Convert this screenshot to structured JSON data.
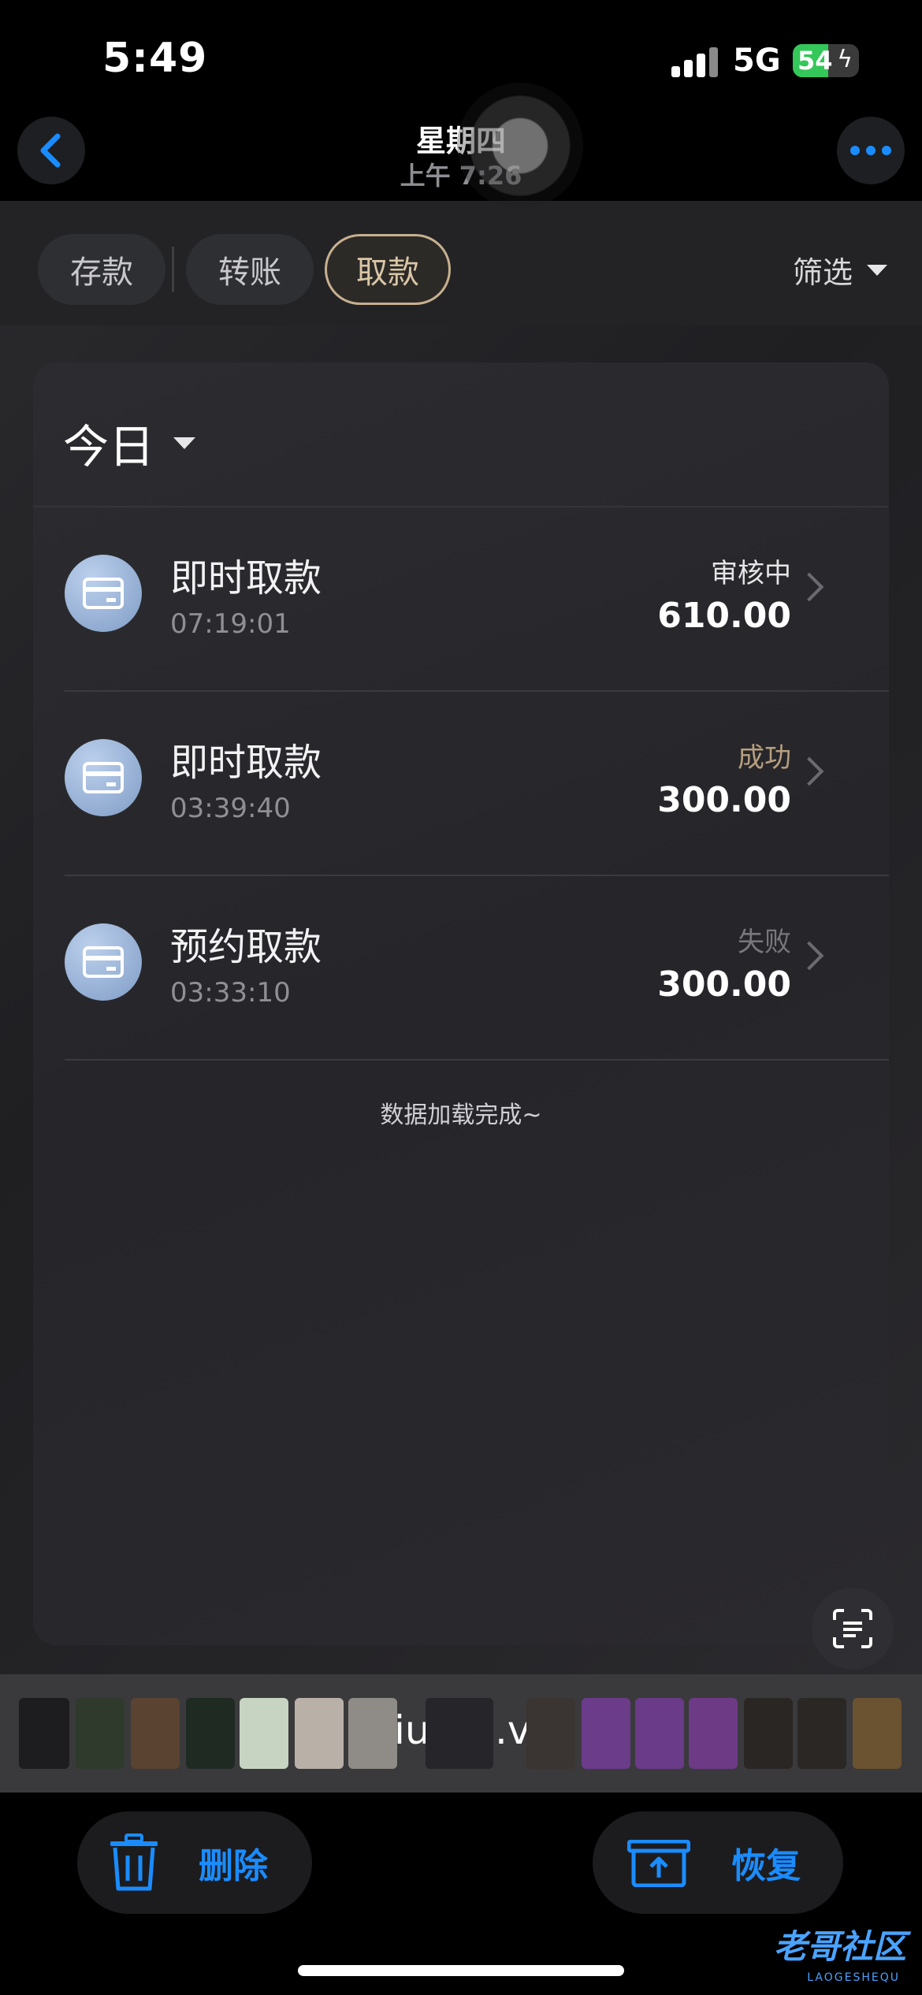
{
  "status_bar": {
    "time": "5:49",
    "network": "5G",
    "battery": "54",
    "battery_level": 0.54
  },
  "viewer_nav": {
    "title": "星期四",
    "subtitle": "上午 7:26"
  },
  "tabs": [
    {
      "label": "存款",
      "active": false
    },
    {
      "label": "转账",
      "active": false
    },
    {
      "label": "取款",
      "active": true
    }
  ],
  "filter": {
    "label": "筛选"
  },
  "period": {
    "label": "今日"
  },
  "transactions": [
    {
      "title": "即时取款",
      "time": "07:19:01",
      "status": "审核中",
      "status_color": "#e6e6e8",
      "amount": "610.00"
    },
    {
      "title": "即时取款",
      "time": "03:39:40",
      "status": "成功",
      "status_color": "#b79f7f",
      "amount": "300.00"
    },
    {
      "title": "预约取款",
      "time": "03:33:10",
      "status": "失败",
      "status_color": "#77777c",
      "amount": "300.00"
    }
  ],
  "load_status": "数据加载完成~",
  "thumbnail_strip": {
    "text_left": "iu",
    "text_right": ".vi"
  },
  "toolbar": {
    "delete_label": "删除",
    "restore_label": "恢复"
  },
  "watermark": {
    "text": "老哥社区",
    "sub": "LAOGESHEQU"
  },
  "colors": {
    "accent_blue": "#1a8cff",
    "active_tab_border": "#c7b08f",
    "battery_green": "#34c759"
  }
}
